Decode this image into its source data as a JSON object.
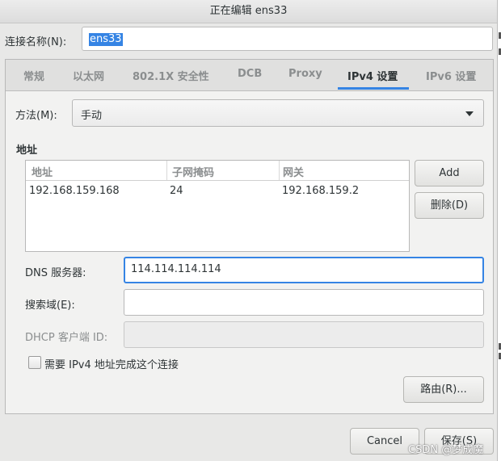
{
  "window": {
    "title": "正在编辑 ens33"
  },
  "connection": {
    "name_label": "连接名称(N):",
    "name_value": "ens33"
  },
  "tabs": [
    {
      "label": "常规"
    },
    {
      "label": "以太网"
    },
    {
      "label": "802.1X 安全性"
    },
    {
      "label": "DCB"
    },
    {
      "label": "Proxy"
    },
    {
      "label": "IPv4 设置",
      "active": true
    },
    {
      "label": "IPv6 设置"
    }
  ],
  "ipv4": {
    "method_label": "方法(M):",
    "method_value": "手动",
    "address_section": "地址",
    "columns": [
      "地址",
      "子网掩码",
      "网关"
    ],
    "rows": [
      [
        "192.168.159.168",
        "24",
        "192.168.159.2"
      ]
    ],
    "add_button": "Add",
    "delete_button": "删除(D)",
    "dns_label": "DNS 服务器:",
    "dns_value": "114.114.114.114",
    "search_label": "搜索域(E):",
    "search_value": "",
    "dhcp_label": "DHCP 客户端 ID:",
    "dhcp_value": "",
    "require_label": "需要 IPv4 地址完成这个连接",
    "require_checked": false,
    "routes_button": "路由(R)..."
  },
  "footer": {
    "cancel": "Cancel",
    "save": "保存(S)"
  },
  "watermark": "CSDN @梦成魔",
  "colors": {
    "accent": "#3584e4",
    "background": "#e8e8e7"
  }
}
